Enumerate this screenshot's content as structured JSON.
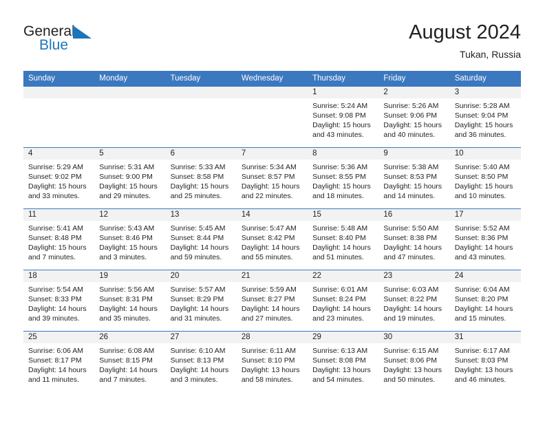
{
  "brand": {
    "name_top": "General",
    "name_bottom": "Blue",
    "mark": "triangle-flag-icon",
    "color_dark": "#231f20",
    "color_blue": "#1b75bb"
  },
  "header": {
    "title": "August 2024",
    "subtitle": "Tukan, Russia"
  },
  "theme": {
    "header_bg": "#3b78c0",
    "header_text": "#ffffff",
    "daynum_bg": "#f2f2f2",
    "row_border": "#3b78c0",
    "body_text": "#231f20"
  },
  "calendar": {
    "weekday_headers": [
      "Sunday",
      "Monday",
      "Tuesday",
      "Wednesday",
      "Thursday",
      "Friday",
      "Saturday"
    ],
    "weeks": [
      [
        {
          "day": "",
          "empty": true
        },
        {
          "day": "",
          "empty": true
        },
        {
          "day": "",
          "empty": true
        },
        {
          "day": "",
          "empty": true
        },
        {
          "day": "1",
          "sunrise": "Sunrise: 5:24 AM",
          "sunset": "Sunset: 9:08 PM",
          "daylight_1": "Daylight: 15 hours",
          "daylight_2": "and 43 minutes."
        },
        {
          "day": "2",
          "sunrise": "Sunrise: 5:26 AM",
          "sunset": "Sunset: 9:06 PM",
          "daylight_1": "Daylight: 15 hours",
          "daylight_2": "and 40 minutes."
        },
        {
          "day": "3",
          "sunrise": "Sunrise: 5:28 AM",
          "sunset": "Sunset: 9:04 PM",
          "daylight_1": "Daylight: 15 hours",
          "daylight_2": "and 36 minutes."
        }
      ],
      [
        {
          "day": "4",
          "sunrise": "Sunrise: 5:29 AM",
          "sunset": "Sunset: 9:02 PM",
          "daylight_1": "Daylight: 15 hours",
          "daylight_2": "and 33 minutes."
        },
        {
          "day": "5",
          "sunrise": "Sunrise: 5:31 AM",
          "sunset": "Sunset: 9:00 PM",
          "daylight_1": "Daylight: 15 hours",
          "daylight_2": "and 29 minutes."
        },
        {
          "day": "6",
          "sunrise": "Sunrise: 5:33 AM",
          "sunset": "Sunset: 8:58 PM",
          "daylight_1": "Daylight: 15 hours",
          "daylight_2": "and 25 minutes."
        },
        {
          "day": "7",
          "sunrise": "Sunrise: 5:34 AM",
          "sunset": "Sunset: 8:57 PM",
          "daylight_1": "Daylight: 15 hours",
          "daylight_2": "and 22 minutes."
        },
        {
          "day": "8",
          "sunrise": "Sunrise: 5:36 AM",
          "sunset": "Sunset: 8:55 PM",
          "daylight_1": "Daylight: 15 hours",
          "daylight_2": "and 18 minutes."
        },
        {
          "day": "9",
          "sunrise": "Sunrise: 5:38 AM",
          "sunset": "Sunset: 8:53 PM",
          "daylight_1": "Daylight: 15 hours",
          "daylight_2": "and 14 minutes."
        },
        {
          "day": "10",
          "sunrise": "Sunrise: 5:40 AM",
          "sunset": "Sunset: 8:50 PM",
          "daylight_1": "Daylight: 15 hours",
          "daylight_2": "and 10 minutes."
        }
      ],
      [
        {
          "day": "11",
          "sunrise": "Sunrise: 5:41 AM",
          "sunset": "Sunset: 8:48 PM",
          "daylight_1": "Daylight: 15 hours",
          "daylight_2": "and 7 minutes."
        },
        {
          "day": "12",
          "sunrise": "Sunrise: 5:43 AM",
          "sunset": "Sunset: 8:46 PM",
          "daylight_1": "Daylight: 15 hours",
          "daylight_2": "and 3 minutes."
        },
        {
          "day": "13",
          "sunrise": "Sunrise: 5:45 AM",
          "sunset": "Sunset: 8:44 PM",
          "daylight_1": "Daylight: 14 hours",
          "daylight_2": "and 59 minutes."
        },
        {
          "day": "14",
          "sunrise": "Sunrise: 5:47 AM",
          "sunset": "Sunset: 8:42 PM",
          "daylight_1": "Daylight: 14 hours",
          "daylight_2": "and 55 minutes."
        },
        {
          "day": "15",
          "sunrise": "Sunrise: 5:48 AM",
          "sunset": "Sunset: 8:40 PM",
          "daylight_1": "Daylight: 14 hours",
          "daylight_2": "and 51 minutes."
        },
        {
          "day": "16",
          "sunrise": "Sunrise: 5:50 AM",
          "sunset": "Sunset: 8:38 PM",
          "daylight_1": "Daylight: 14 hours",
          "daylight_2": "and 47 minutes."
        },
        {
          "day": "17",
          "sunrise": "Sunrise: 5:52 AM",
          "sunset": "Sunset: 8:36 PM",
          "daylight_1": "Daylight: 14 hours",
          "daylight_2": "and 43 minutes."
        }
      ],
      [
        {
          "day": "18",
          "sunrise": "Sunrise: 5:54 AM",
          "sunset": "Sunset: 8:33 PM",
          "daylight_1": "Daylight: 14 hours",
          "daylight_2": "and 39 minutes."
        },
        {
          "day": "19",
          "sunrise": "Sunrise: 5:56 AM",
          "sunset": "Sunset: 8:31 PM",
          "daylight_1": "Daylight: 14 hours",
          "daylight_2": "and 35 minutes."
        },
        {
          "day": "20",
          "sunrise": "Sunrise: 5:57 AM",
          "sunset": "Sunset: 8:29 PM",
          "daylight_1": "Daylight: 14 hours",
          "daylight_2": "and 31 minutes."
        },
        {
          "day": "21",
          "sunrise": "Sunrise: 5:59 AM",
          "sunset": "Sunset: 8:27 PM",
          "daylight_1": "Daylight: 14 hours",
          "daylight_2": "and 27 minutes."
        },
        {
          "day": "22",
          "sunrise": "Sunrise: 6:01 AM",
          "sunset": "Sunset: 8:24 PM",
          "daylight_1": "Daylight: 14 hours",
          "daylight_2": "and 23 minutes."
        },
        {
          "day": "23",
          "sunrise": "Sunrise: 6:03 AM",
          "sunset": "Sunset: 8:22 PM",
          "daylight_1": "Daylight: 14 hours",
          "daylight_2": "and 19 minutes."
        },
        {
          "day": "24",
          "sunrise": "Sunrise: 6:04 AM",
          "sunset": "Sunset: 8:20 PM",
          "daylight_1": "Daylight: 14 hours",
          "daylight_2": "and 15 minutes."
        }
      ],
      [
        {
          "day": "25",
          "sunrise": "Sunrise: 6:06 AM",
          "sunset": "Sunset: 8:17 PM",
          "daylight_1": "Daylight: 14 hours",
          "daylight_2": "and 11 minutes."
        },
        {
          "day": "26",
          "sunrise": "Sunrise: 6:08 AM",
          "sunset": "Sunset: 8:15 PM",
          "daylight_1": "Daylight: 14 hours",
          "daylight_2": "and 7 minutes."
        },
        {
          "day": "27",
          "sunrise": "Sunrise: 6:10 AM",
          "sunset": "Sunset: 8:13 PM",
          "daylight_1": "Daylight: 14 hours",
          "daylight_2": "and 3 minutes."
        },
        {
          "day": "28",
          "sunrise": "Sunrise: 6:11 AM",
          "sunset": "Sunset: 8:10 PM",
          "daylight_1": "Daylight: 13 hours",
          "daylight_2": "and 58 minutes."
        },
        {
          "day": "29",
          "sunrise": "Sunrise: 6:13 AM",
          "sunset": "Sunset: 8:08 PM",
          "daylight_1": "Daylight: 13 hours",
          "daylight_2": "and 54 minutes."
        },
        {
          "day": "30",
          "sunrise": "Sunrise: 6:15 AM",
          "sunset": "Sunset: 8:06 PM",
          "daylight_1": "Daylight: 13 hours",
          "daylight_2": "and 50 minutes."
        },
        {
          "day": "31",
          "sunrise": "Sunrise: 6:17 AM",
          "sunset": "Sunset: 8:03 PM",
          "daylight_1": "Daylight: 13 hours",
          "daylight_2": "and 46 minutes."
        }
      ]
    ]
  }
}
